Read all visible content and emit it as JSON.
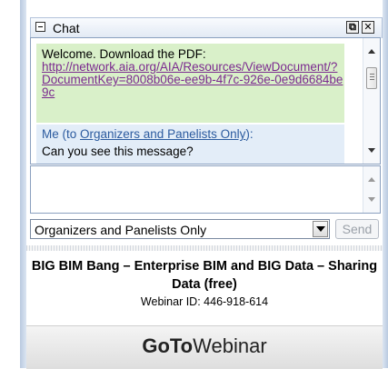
{
  "chat": {
    "title": "Chat",
    "popout_glyph": "⧉",
    "close_glyph": "✕",
    "messages": {
      "system_text": "Welcome. Download the PDF:",
      "system_link": "http://network.aia.org/AIA/Resources/ViewDocument/?DocumentKey=8008b06e-ee9b-4f7c-926e-0e9d6684be9c",
      "me_prefix": "Me (to ",
      "me_recipient_link": "Organizers and Panelists Only",
      "me_suffix": "):",
      "me_text": "Can you see this message?"
    },
    "input": {
      "value": "",
      "placeholder": ""
    },
    "recipient": {
      "selected": "Organizers and Panelists Only"
    },
    "send_label": "Send"
  },
  "webinar": {
    "title": "BIG BIM Bang – Enterprise BIM and BIG Data – Sharing Data (free)",
    "id_label": "Webinar ID: 446-918-614"
  },
  "brand": {
    "part1": "GoTo",
    "part2": "Webinar"
  },
  "icons": [
    "collapse-icon",
    "popout-icon",
    "close-icon",
    "chevron-up-icon",
    "chevron-down-icon",
    "dropdown-arrow-icon"
  ]
}
